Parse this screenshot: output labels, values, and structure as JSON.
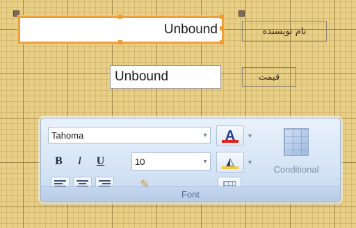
{
  "controls": {
    "unbound_top": "Unbound",
    "unbound_mid": "Unbound",
    "label_author": "نام نویسنده",
    "label_price": "قیمت"
  },
  "ribbon": {
    "font_name": "Tahoma",
    "font_size": "10",
    "bold": "B",
    "italic": "I",
    "underline": "U",
    "font_color_letter": "A",
    "conditional_label": "Conditional",
    "group_title": "Font"
  },
  "colors": {
    "font_color_bar": "#e0201a",
    "fill_color_bar": "#f2c94c",
    "selection": "#f0a03a",
    "grid": "#e8cf85"
  }
}
